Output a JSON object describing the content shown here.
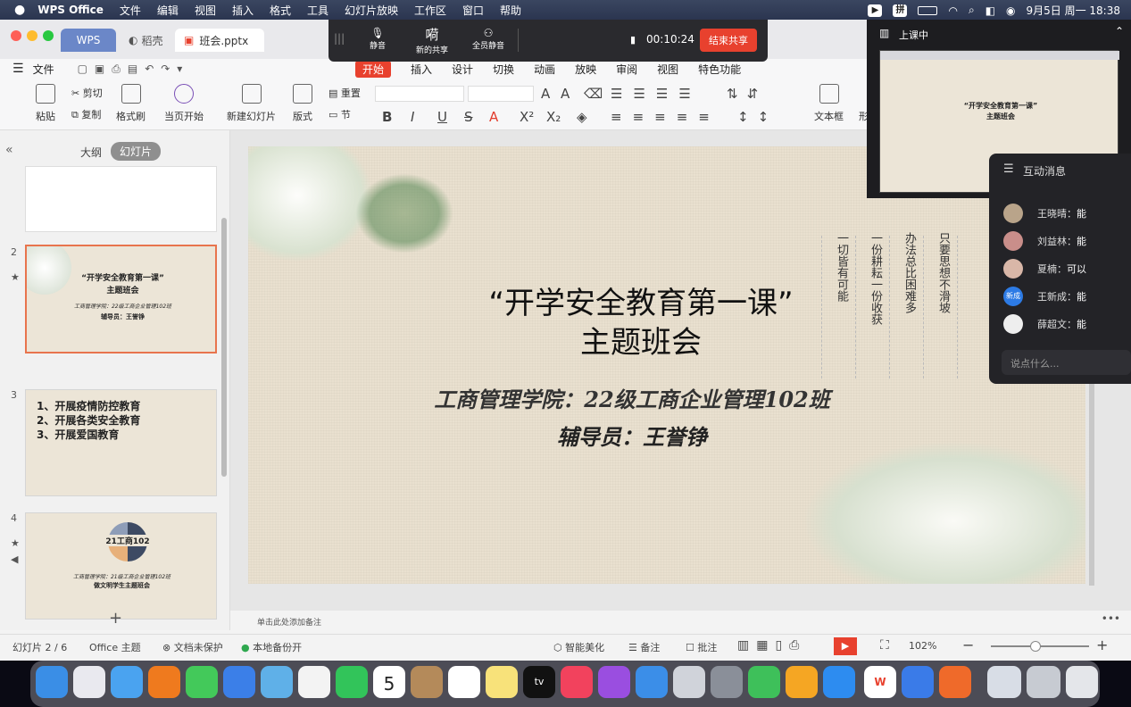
{
  "menubar": {
    "app": "WPS Office",
    "items": [
      "文件",
      "编辑",
      "视图",
      "插入",
      "格式",
      "工具",
      "幻灯片放映",
      "工作区",
      "窗口",
      "帮助"
    ],
    "ime": "拼",
    "datetime": "9月5日 周一  18:38"
  },
  "titlebar": {
    "tabs": [
      "WPS",
      "稻壳",
      "班会.pptx"
    ]
  },
  "file_menu": "文件",
  "ribbon_tabs": [
    "开始",
    "插入",
    "设计",
    "切换",
    "动画",
    "放映",
    "审阅",
    "视图",
    "特色功能"
  ],
  "ribbon": {
    "paste": "粘贴",
    "cut": "剪切",
    "copy": "复制",
    "format_painter": "格式刷",
    "play_current": "当页开始",
    "new_slide": "新建幻灯片",
    "layout": "版式",
    "reset": "重置",
    "section": "节",
    "textbox": "文本框",
    "shape_partial": "形"
  },
  "sharebar": {
    "mute": "静音",
    "new_share": "新的共享",
    "mute_all": "全员静音",
    "timer": "00:10:24",
    "end_share": "结束共享",
    "title_glyph": "嗬"
  },
  "live": {
    "status": "上课中"
  },
  "chat": {
    "title": "互动消息",
    "messages": [
      {
        "name": "王晓晴",
        "text": "能"
      },
      {
        "name": "刘益林",
        "text": "能"
      },
      {
        "name": "夏楠",
        "text": "可以"
      },
      {
        "name": "王新成",
        "text": "能",
        "avatar": "新成"
      },
      {
        "name": "薛超文",
        "text": "能"
      }
    ],
    "placeholder": "说点什么..."
  },
  "leftpanel": {
    "tabs": [
      "大纲",
      "幻灯片"
    ],
    "add": "+",
    "slides": [
      {
        "num": "2",
        "title": "“开学安全教育第一课”",
        "subtitle": "主题班会",
        "line1": "工商管理学院：22级工商企业管理102班",
        "line2": "辅导员：王誉铮"
      },
      {
        "num": "3",
        "items": [
          "1、开展疫情防控教育",
          "2、开展各类安全教育",
          "3、开展爱国教育"
        ]
      },
      {
        "num": "4",
        "badge": "21工商102",
        "line1": "工商管理学院：21级工商企业管理102班",
        "line2": "做文明学生主题班会"
      }
    ]
  },
  "slide": {
    "title1": "“开学安全教育第一课”",
    "title2": "主题班会",
    "college": "工商管理学院：22级工商企业管理102班",
    "advisor": "辅导员：王誉铮",
    "columns": [
      "只要思想不滑坡",
      "办法总比困难多",
      "一份耕耘一份收获",
      "一切皆有可能"
    ]
  },
  "notes_placeholder": "单击此处添加备注",
  "status": {
    "slide_count": "幻灯片 2 / 6",
    "theme": "Office 主题",
    "protect": "文档未保护",
    "backup": "本地备份开",
    "beautify": "智能美化",
    "notes": "备注",
    "comment": "批注",
    "zoom": "102%"
  },
  "colors": {
    "accent_red": "#e23c2c",
    "share_end": "#e8412e",
    "tab_active": "#e8412e"
  }
}
